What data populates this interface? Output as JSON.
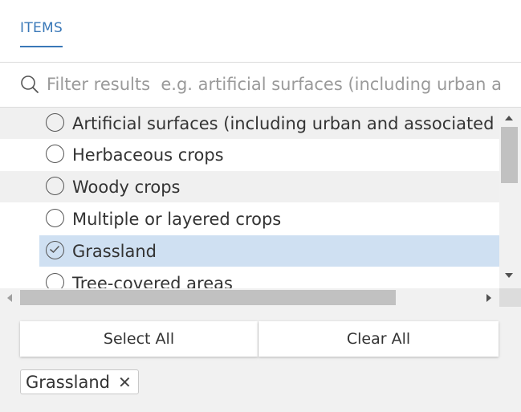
{
  "tabs": [
    {
      "label": "ITEMS"
    }
  ],
  "search": {
    "placeholder": "Filter results  e.g. artificial surfaces (including urban a"
  },
  "list": {
    "items": [
      {
        "label": "Artificial surfaces (including urban and associated are",
        "selected": false
      },
      {
        "label": "Herbaceous crops",
        "selected": false
      },
      {
        "label": "Woody crops",
        "selected": false
      },
      {
        "label": "Multiple or layered crops",
        "selected": false
      },
      {
        "label": "Grassland",
        "selected": true
      },
      {
        "label": "Tree-covered areas",
        "selected": false
      }
    ]
  },
  "footer": {
    "select_all_label": "Select All",
    "clear_all_label": "Clear All",
    "chips": [
      {
        "label": "Grassland",
        "remove_glyph": "✕"
      }
    ]
  },
  "colors": {
    "accent": "#3a78b8",
    "selected_row": "#cfe0f2",
    "alt_row": "#f0f0f0"
  },
  "icons": {
    "search": "search-icon",
    "radio_checked": "check-icon",
    "chip_remove": "close-icon"
  }
}
